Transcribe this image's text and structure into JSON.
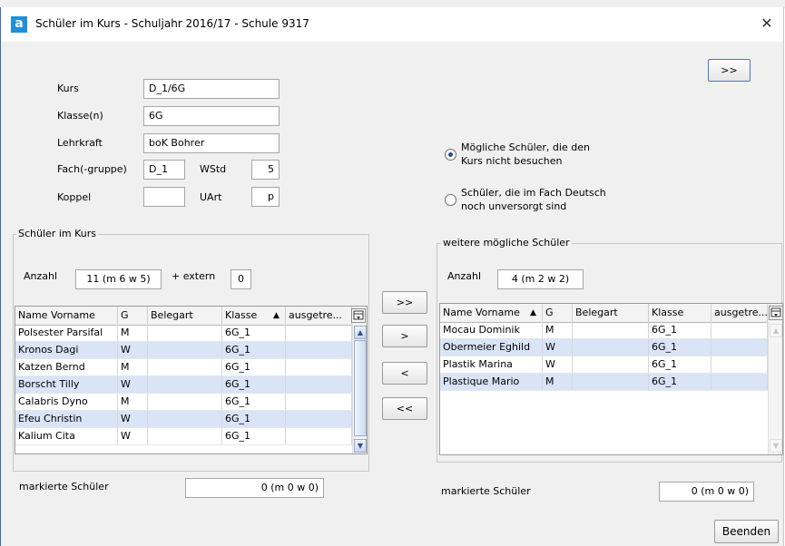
{
  "window": {
    "title": "Schüler im Kurs - Schuljahr 2016/17 - Schule 9317",
    "app_icon_letter": "a",
    "close_glyph": "✕"
  },
  "form": {
    "kurs_label": "Kurs",
    "kurs_value": "D_1/6G",
    "klasse_label": "Klasse(n)",
    "klasse_value": "6G",
    "lehrkraft_label": "Lehrkraft",
    "lehrkraft_value": "boK Bohrer",
    "fach_label": "Fach(-gruppe)",
    "fach_value": "D_1",
    "wstd_label": "WStd",
    "wstd_value": "5",
    "koppel_label": "Koppel",
    "koppel_value": "",
    "uart_label": "UArt",
    "uart_value": "p"
  },
  "top_button": ">>",
  "options": {
    "option1": "Mögliche Schüler, die den Kurs nicht besuchen",
    "option1_line1": "Mögliche Schüler, die den",
    "option1_line2": "Kurs nicht besuchen",
    "option2_line1": "Schüler, die im Fach Deutsch",
    "option2_line2": "noch unversorgt sind",
    "selected": 1
  },
  "left_panel": {
    "title": "Schüler im Kurs",
    "count_label": "Anzahl",
    "count_value": "11 (m 6 w 5)",
    "extern_label": "+ extern",
    "extern_value": "0",
    "columns": [
      "Name Vorname",
      "G",
      "Belegart",
      "Klasse",
      "ausgetre..."
    ],
    "sort_indicator": "▲",
    "rows": [
      {
        "name": "Polsester Parsifal",
        "g": "M",
        "belegart": "",
        "klasse": "6G_1",
        "ausgetreten": ""
      },
      {
        "name": "Kronos Dagi",
        "g": "W",
        "belegart": "",
        "klasse": "6G_1",
        "ausgetreten": ""
      },
      {
        "name": "Katzen Bernd",
        "g": "M",
        "belegart": "",
        "klasse": "6G_1",
        "ausgetreten": ""
      },
      {
        "name": "Borscht Tilly",
        "g": "W",
        "belegart": "",
        "klasse": "6G_1",
        "ausgetreten": ""
      },
      {
        "name": "Calabris Dyno",
        "g": "M",
        "belegart": "",
        "klasse": "6G_1",
        "ausgetreten": ""
      },
      {
        "name": "Efeu Christin",
        "g": "W",
        "belegart": "",
        "klasse": "6G_1",
        "ausgetreten": ""
      },
      {
        "name": "Kalium Cita",
        "g": "W",
        "belegart": "",
        "klasse": "6G_1",
        "ausgetreten": ""
      }
    ],
    "marked_label": "markierte Schüler",
    "marked_value": "0 (m 0 w 0)"
  },
  "transfer_buttons": {
    "all_right": ">>",
    "one_right": ">",
    "one_left": "<",
    "all_left": "<<"
  },
  "right_panel": {
    "title": "weitere mögliche Schüler",
    "count_label": "Anzahl",
    "count_value": "4 (m 2 w 2)",
    "columns": [
      "Name Vorname",
      "G",
      "Belegart",
      "Klasse",
      "ausgetre..."
    ],
    "sort_indicator": "▲",
    "rows": [
      {
        "name": "Mocau Dominik",
        "g": "M",
        "belegart": "",
        "klasse": "6G_1",
        "ausgetreten": ""
      },
      {
        "name": "Obermeier Eghild",
        "g": "W",
        "belegart": "",
        "klasse": "6G_1",
        "ausgetreten": ""
      },
      {
        "name": "Plastik Marina",
        "g": "W",
        "belegart": "",
        "klasse": "6G_1",
        "ausgetreten": ""
      },
      {
        "name": "Plastique Mario",
        "g": "M",
        "belegart": "",
        "klasse": "6G_1",
        "ausgetreten": ""
      }
    ],
    "marked_label": "markierte Schüler",
    "marked_value": "0 (m 0 w 0)"
  },
  "footer": {
    "close_button": "Beenden"
  },
  "icons": {
    "column_picker": "column-picker-icon",
    "scroll_up": "scroll-up-icon",
    "scroll_down": "scroll-down-icon"
  },
  "colors": {
    "row_alt": "#d9e4f7",
    "app_icon": "#1f90d9",
    "window_border": "#3d6ab3"
  }
}
